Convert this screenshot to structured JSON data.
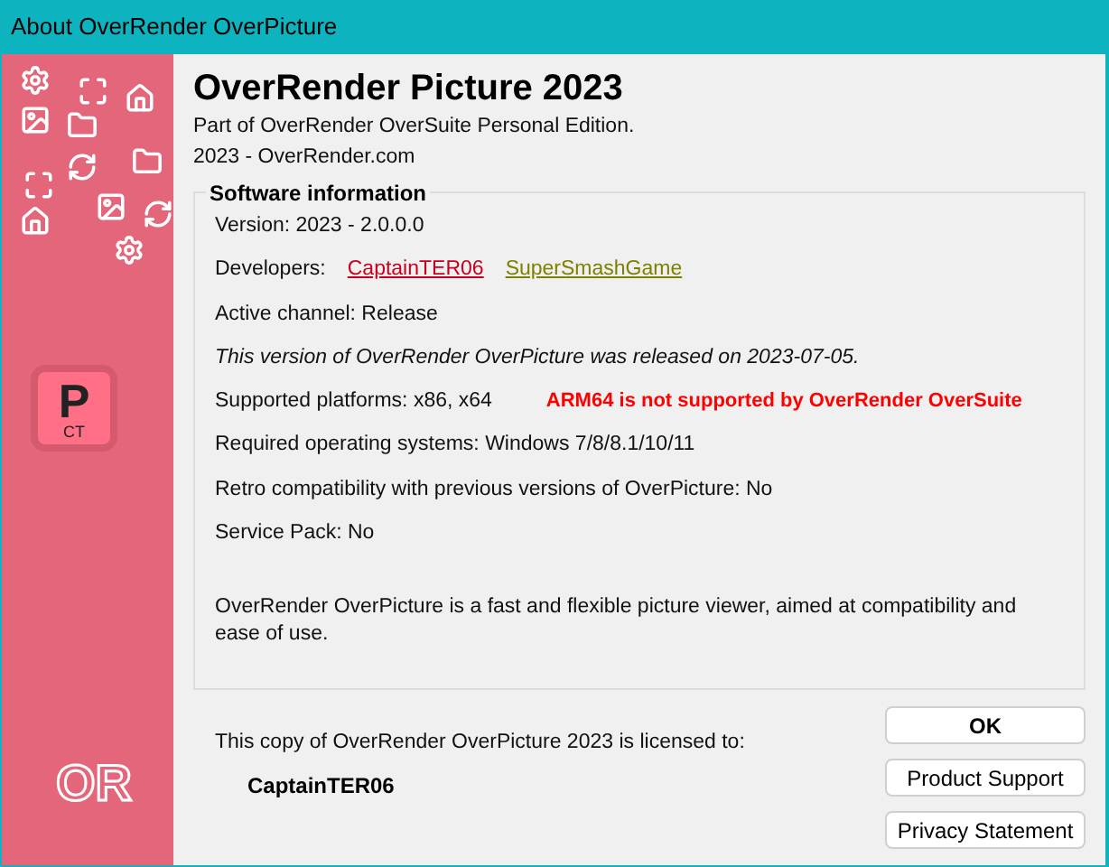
{
  "window": {
    "title": "About OverRender OverPicture"
  },
  "sidebar": {
    "logo": {
      "letter": "P",
      "caption": "CT"
    },
    "brand": "OR"
  },
  "header": {
    "title": "OverRender Picture 2023",
    "subtitle": "Part of OverRender OverSuite Personal Edition.",
    "website": "2023 - OverRender.com"
  },
  "software_info": {
    "title": "Software information",
    "version": "Version: 2023 - 2.0.0.0",
    "developers_label": "Developers:",
    "developers": [
      {
        "name": "CaptainTER06",
        "color": "#c8001e"
      },
      {
        "name": "SuperSmashGame",
        "color": "#808000"
      }
    ],
    "channel": "Active channel: Release",
    "release_note": "This version of OverRender OverPicture was released on 2023-07-05.",
    "platforms": "Supported platforms: x86, x64",
    "platform_warning": "ARM64 is not supported by OverRender OverSuite",
    "os": "Required operating systems: Windows 7/8/8.1/10/11",
    "retro": "Retro compatibility with previous versions of OverPicture: No",
    "service_pack": "Service Pack: No",
    "description": "OverRender OverPicture is a fast and flexible picture viewer, aimed at compatibility and ease of use."
  },
  "license": {
    "text": "This copy of OverRender OverPicture 2023 is licensed to:",
    "owner": "CaptainTER06"
  },
  "buttons": [
    "OK",
    "Product Support",
    "Privacy Statement"
  ]
}
